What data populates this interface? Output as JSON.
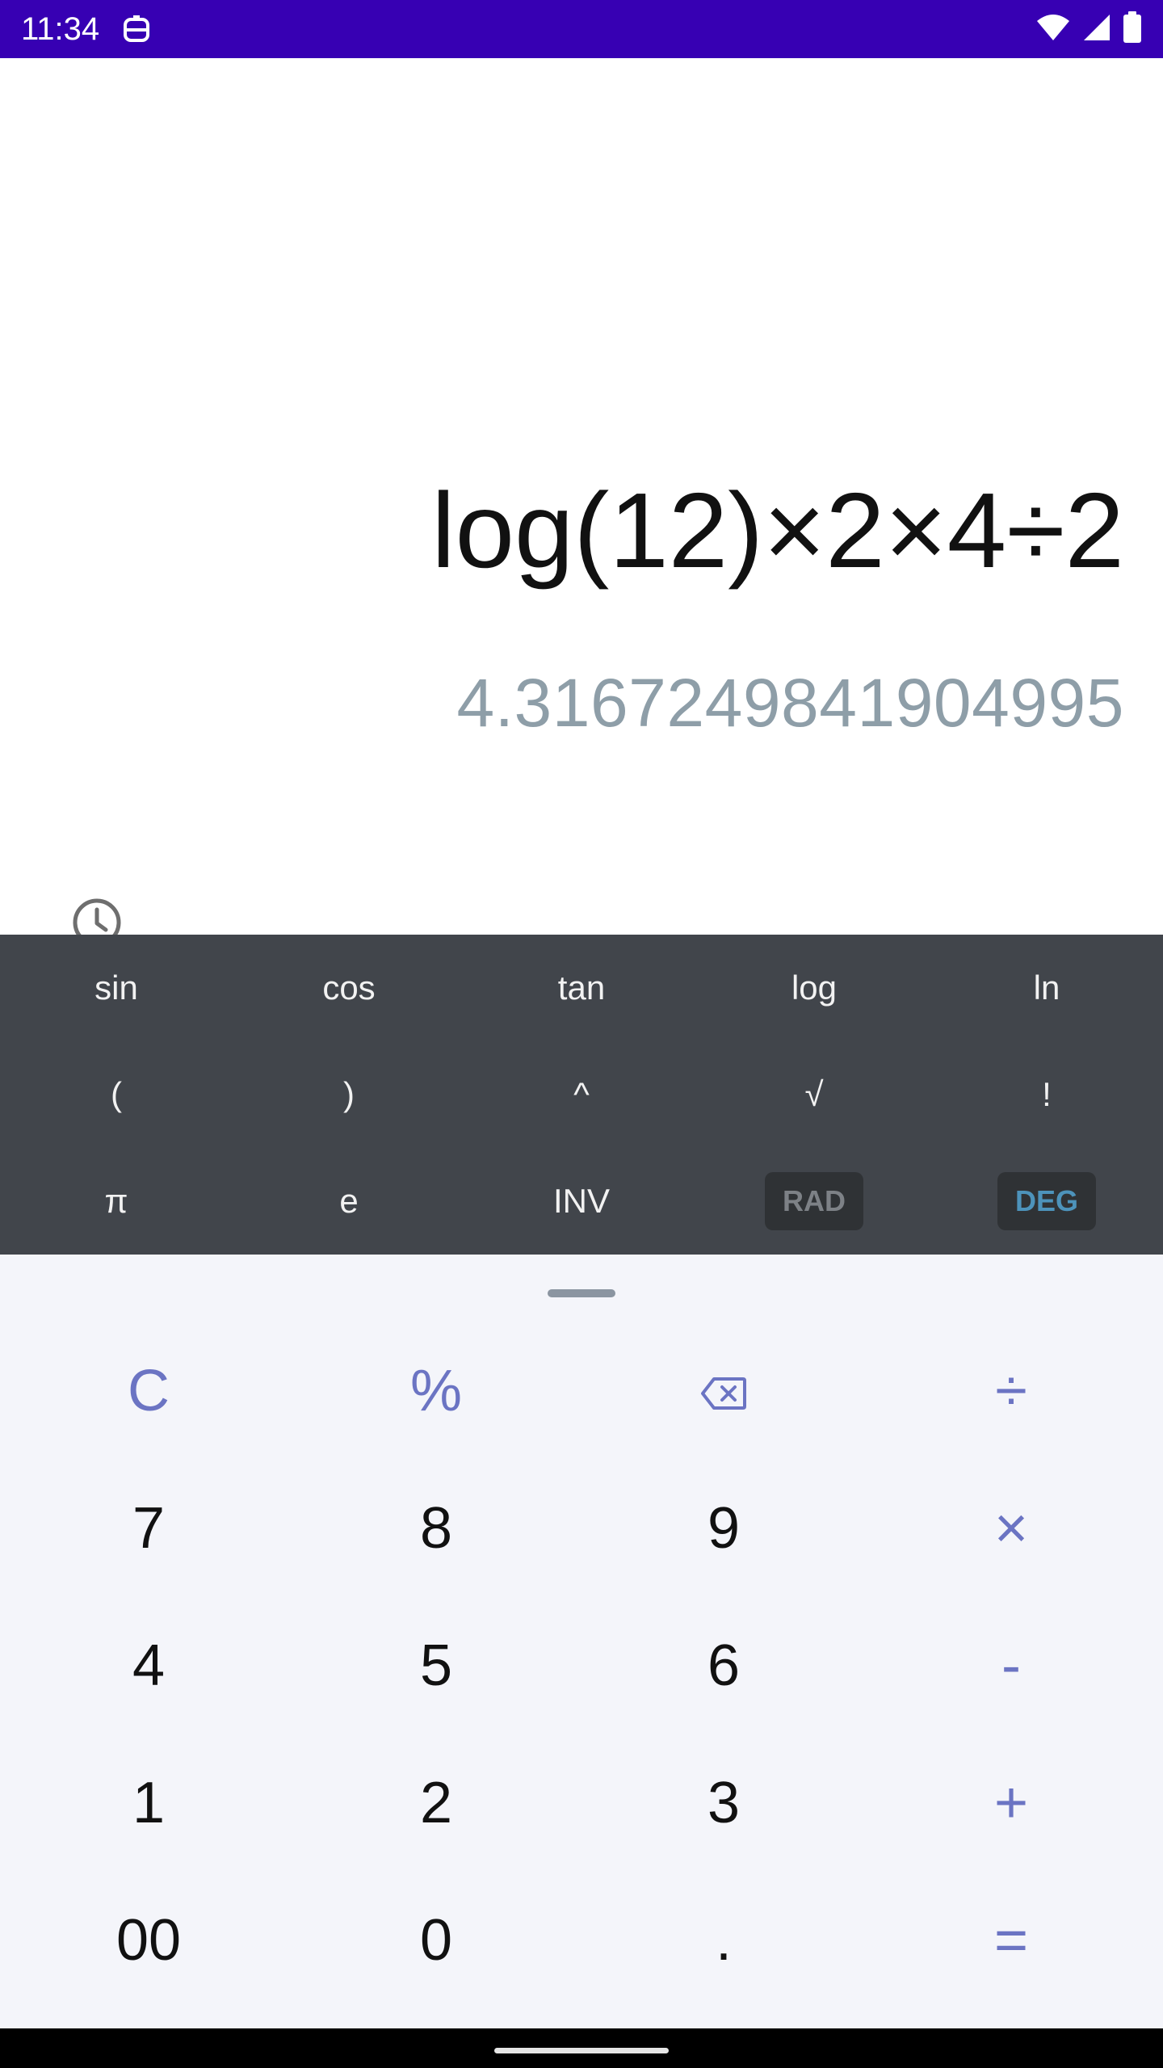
{
  "status_bar": {
    "time": "11:34",
    "app_icon": "notification-app-icon",
    "wifi_icon": "wifi-icon",
    "signal_icon": "cell-signal-icon",
    "battery_icon": "battery-icon",
    "background_color": "#3700b3"
  },
  "display": {
    "expression": "log(12)×2×4÷2",
    "result": "4.3167249841904995",
    "history_icon": "history-clock-icon"
  },
  "scientific": {
    "rows": [
      [
        "sin",
        "cos",
        "tan",
        "log",
        "ln"
      ],
      [
        "(",
        ")",
        "^",
        "√",
        "!"
      ],
      [
        "π",
        "e",
        "INV",
        "RAD",
        "DEG"
      ]
    ],
    "active_mode": "DEG",
    "background_color": "#41454b"
  },
  "keypad": {
    "rows": [
      [
        "C",
        "%",
        "⌫",
        "÷"
      ],
      [
        "7",
        "8",
        "9",
        "×"
      ],
      [
        "4",
        "5",
        "6",
        "-"
      ],
      [
        "1",
        "2",
        "3",
        "+"
      ],
      [
        "00",
        "0",
        ".",
        "="
      ]
    ],
    "backspace_icon": "backspace-icon",
    "accent_color": "#6b74c3",
    "background_color": "#f4f5fa"
  }
}
